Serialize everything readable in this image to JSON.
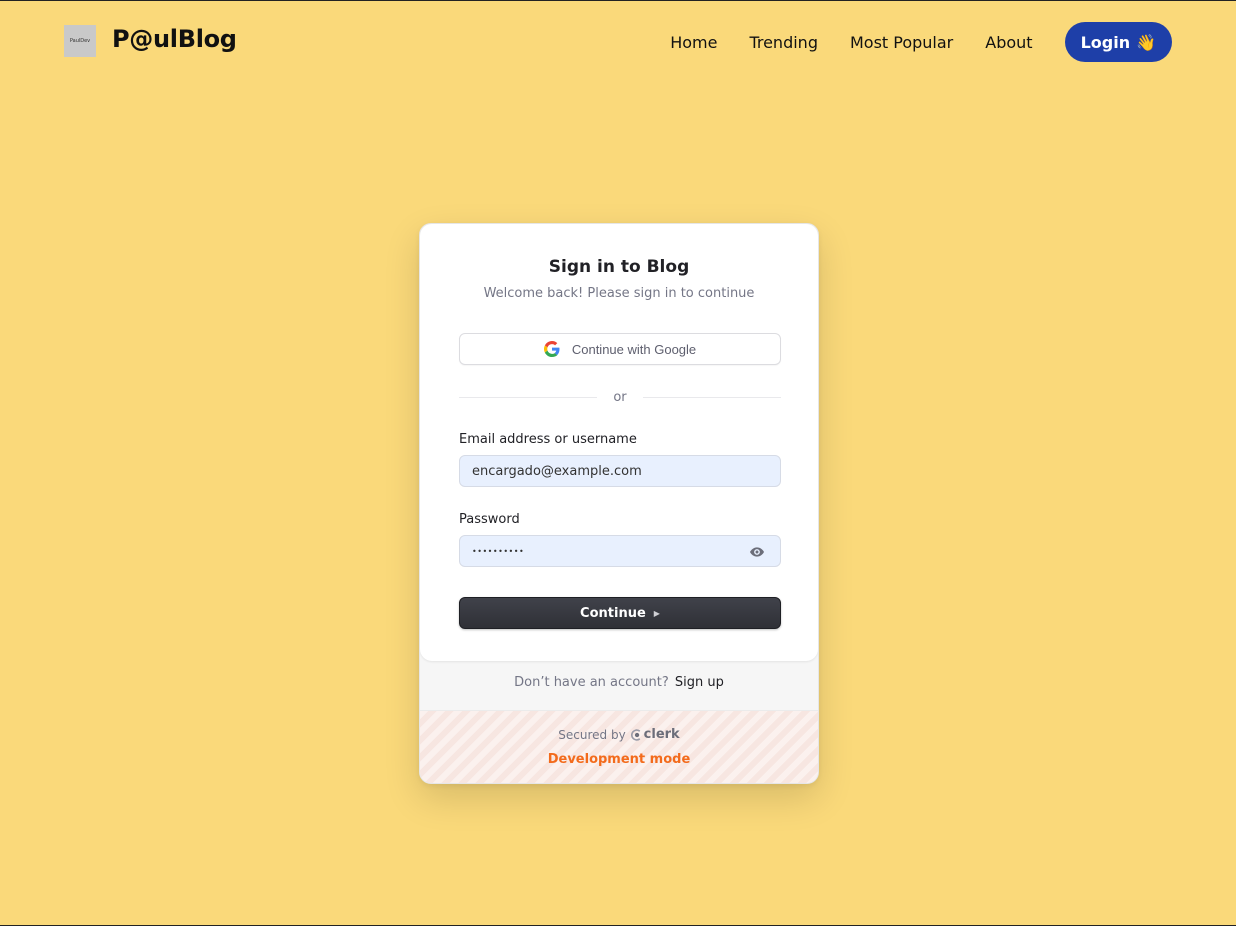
{
  "header": {
    "logo_text": "PaulDev",
    "brand": "P@ulBlog",
    "nav": [
      "Home",
      "Trending",
      "Most Popular",
      "About"
    ],
    "login_label": "Login",
    "login_icon": "waving-hand-icon",
    "login_emoji": "👋",
    "accent_color": "#1e3fa8",
    "background_color": "#fad97a"
  },
  "signin": {
    "title": "Sign in to Blog",
    "subtitle": "Welcome back! Please sign in to continue",
    "google_label": "Continue with Google",
    "divider_text": "or",
    "email_label": "Email address or username",
    "email_value": "encargado@example.com",
    "password_label": "Password",
    "password_value": "••••••••••",
    "continue_label": "Continue",
    "no_account_text": "Don’t have an account?",
    "signup_label": "Sign up",
    "secured_by": "Secured by",
    "provider": "clerk",
    "dev_mode": "Development mode",
    "dev_mode_color": "#f36b1c"
  }
}
